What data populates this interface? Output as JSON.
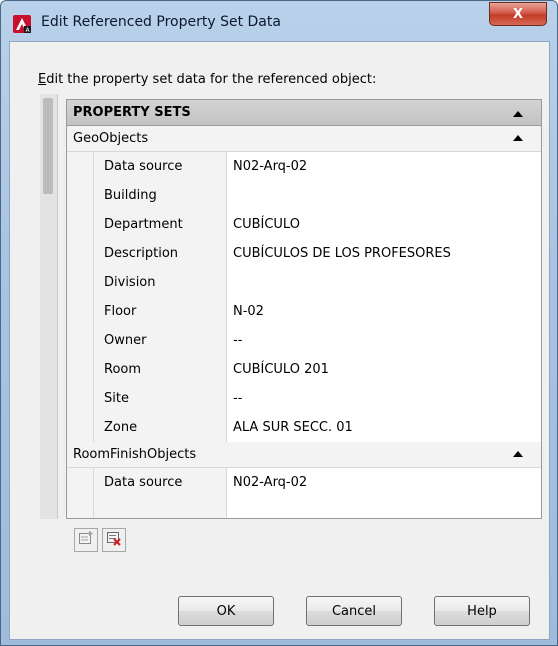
{
  "window": {
    "title": "Edit Referenced Property Set Data",
    "close_glyph": "X"
  },
  "instruction": {
    "mnemonic": "E",
    "rest": "dit the property set data for the referenced object:"
  },
  "grid": {
    "header": "PROPERTY SETS",
    "groups": [
      {
        "name": "GeoObjects",
        "properties": [
          {
            "name": "Data source",
            "value": "N02-Arq-02"
          },
          {
            "name": "Building",
            "value": ""
          },
          {
            "name": "Department",
            "value": "CUBÍCULO"
          },
          {
            "name": "Description",
            "value": "CUBÍCULOS DE LOS PROFESORES"
          },
          {
            "name": "Division",
            "value": ""
          },
          {
            "name": "Floor",
            "value": "N-02"
          },
          {
            "name": "Owner",
            "value": "--"
          },
          {
            "name": "Room",
            "value": "CUBÍCULO 201"
          },
          {
            "name": "Site",
            "value": "--"
          },
          {
            "name": "Zone",
            "value": "ALA SUR SECC. 01"
          }
        ]
      },
      {
        "name": "RoomFinishObjects",
        "properties": [
          {
            "name": "Data source",
            "value": "N02-Arq-02"
          }
        ]
      }
    ]
  },
  "toolbar": {
    "add_icon": "add-property-set-icon",
    "remove_icon": "remove-property-set-icon"
  },
  "buttons": {
    "ok": "OK",
    "cancel": "Cancel",
    "help": "Help"
  }
}
